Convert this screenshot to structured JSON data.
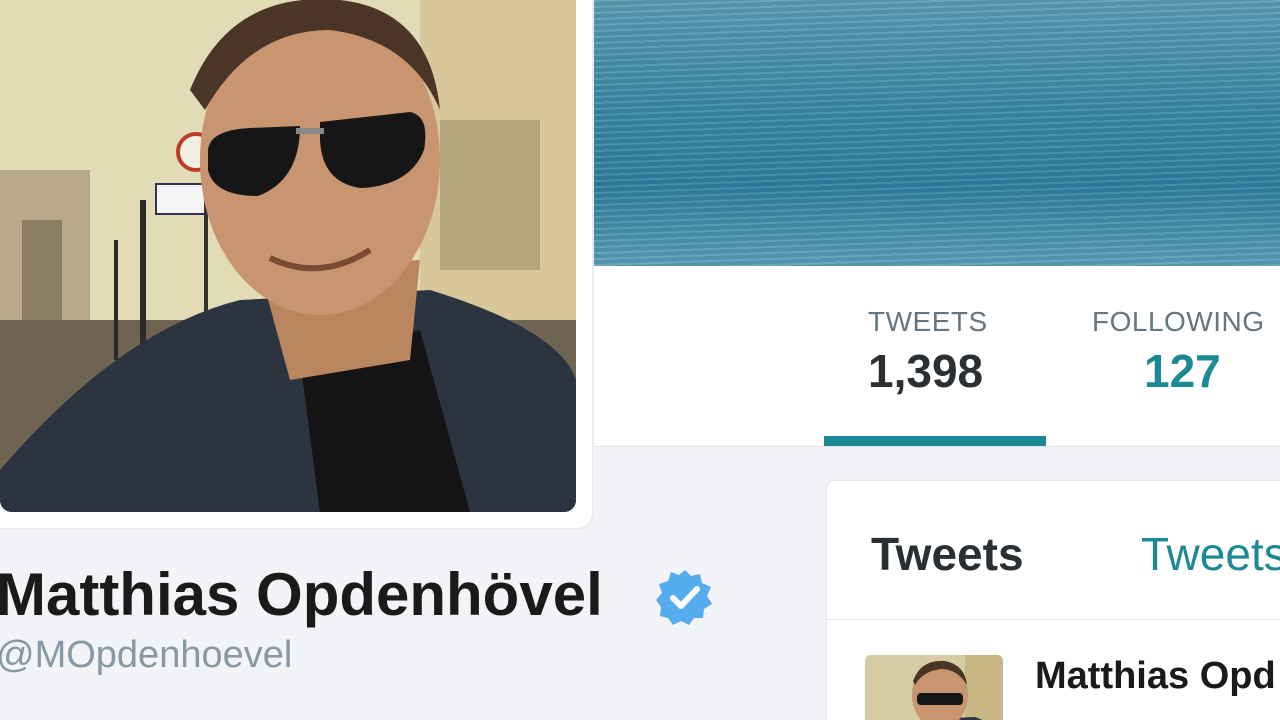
{
  "profile": {
    "name": "Matthias Opdenhövel",
    "handle": "@MOpdenhoevel",
    "verified_icon": "verified-badge-icon"
  },
  "stats": {
    "tweets_label": "TWEETS",
    "tweets_value": "1,398",
    "following_label": "FOLLOWING",
    "following_value": "127"
  },
  "timeline": {
    "tab_active": "Tweets",
    "tab_other": "Tweets",
    "first_tweet_author": "Matthias Opd"
  },
  "colors": {
    "accent": "#1b8a94",
    "verified": "#55acee",
    "text": "#1a1a1a",
    "muted": "#8899a6"
  }
}
